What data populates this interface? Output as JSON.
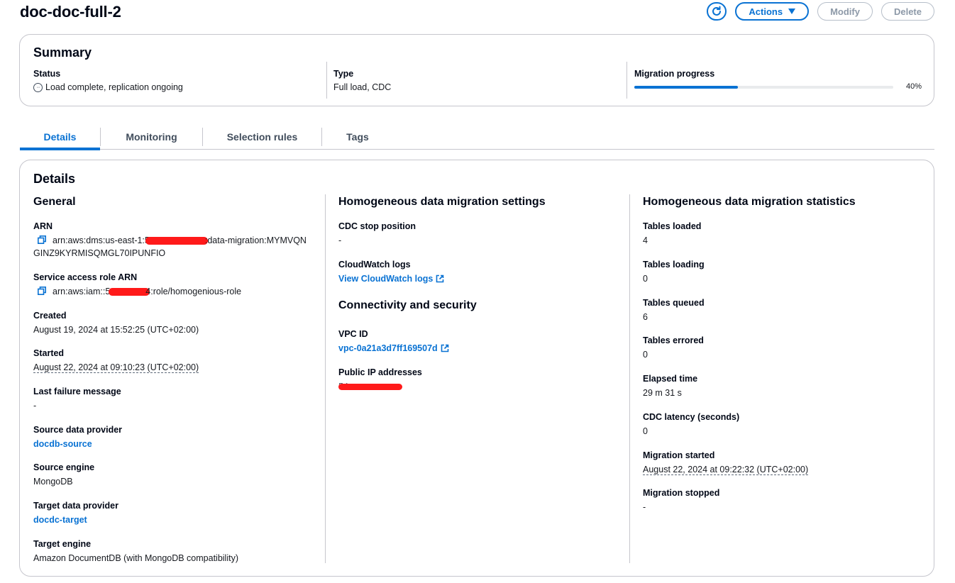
{
  "header": {
    "title": "doc-doc-full-2",
    "actions_label": "Actions",
    "modify_label": "Modify",
    "delete_label": "Delete"
  },
  "summary": {
    "title": "Summary",
    "status_label": "Status",
    "status_value": "Load complete, replication ongoing",
    "type_label": "Type",
    "type_value": "Full load, CDC",
    "progress_label": "Migration progress",
    "progress_percent": 40,
    "progress_text": "40%"
  },
  "tabs": [
    {
      "label": "Details",
      "active": true
    },
    {
      "label": "Monitoring",
      "active": false
    },
    {
      "label": "Selection rules",
      "active": false
    },
    {
      "label": "Tags",
      "active": false
    }
  ],
  "details": {
    "title": "Details",
    "general": {
      "heading": "General",
      "arn_label": "ARN",
      "arn_value_prefix": "arn:aws:dms:us-east-1:5",
      "arn_value_suffix": ":data-migration:MYMVQN",
      "arn_value_line2": "GINZ9KYRMISQMGL70IPUNFIO",
      "role_label": "Service access role ARN",
      "role_value_prefix": "arn:aws:iam::5",
      "role_value_suffix": "4:role/homogenious-role",
      "created_label": "Created",
      "created_value": "August 19, 2024 at 15:52:25 (UTC+02:00)",
      "started_label": "Started",
      "started_value": "August 22, 2024 at 09:10:23 (UTC+02:00)",
      "failure_label": "Last failure message",
      "failure_value": "-",
      "source_provider_label": "Source data provider",
      "source_provider_value": "docdb-source",
      "source_engine_label": "Source engine",
      "source_engine_value": "MongoDB",
      "target_provider_label": "Target data provider",
      "target_provider_value": "docdc-target",
      "target_engine_label": "Target engine",
      "target_engine_value": "Amazon DocumentDB (with MongoDB compatibility)"
    },
    "settings": {
      "heading": "Homogeneous data migration settings",
      "cdc_stop_label": "CDC stop position",
      "cdc_stop_value": "-",
      "cloudwatch_label": "CloudWatch logs",
      "cloudwatch_link": "View CloudWatch logs",
      "connectivity_heading": "Connectivity and security",
      "vpc_label": "VPC ID",
      "vpc_value": "vpc-0a21a3d7ff169507d",
      "public_ip_label": "Public IP addresses",
      "public_ip_value": "54"
    },
    "statistics": {
      "heading": "Homogeneous data migration statistics",
      "tables_loaded_label": "Tables loaded",
      "tables_loaded_value": "4",
      "tables_loading_label": "Tables loading",
      "tables_loading_value": "0",
      "tables_queued_label": "Tables queued",
      "tables_queued_value": "6",
      "tables_errored_label": "Tables errored",
      "tables_errored_value": "0",
      "elapsed_label": "Elapsed time",
      "elapsed_value": "29 m 31 s",
      "cdc_latency_label": "CDC latency (seconds)",
      "cdc_latency_value": "0",
      "migration_started_label": "Migration started",
      "migration_started_value": "August 22, 2024 at 09:22:32 (UTC+02:00)",
      "migration_stopped_label": "Migration stopped",
      "migration_stopped_value": "-"
    }
  },
  "colors": {
    "accent": "#0972d3",
    "redaction": "#ff1a1a",
    "border": "#c6c6cd",
    "disabled": "#8d99a8"
  },
  "icons": [
    "refresh-icon",
    "caret-down-icon",
    "status-in-progress-icon",
    "copy-icon",
    "external-link-icon"
  ]
}
